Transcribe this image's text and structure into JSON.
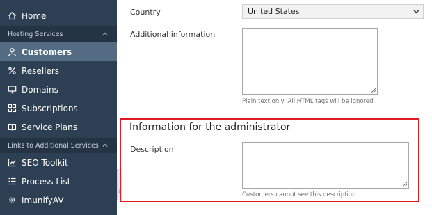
{
  "sidebar": {
    "home": "Home",
    "hosting_section": "Hosting Services",
    "items": [
      {
        "label": "Customers",
        "icon": "user-icon"
      },
      {
        "label": "Resellers",
        "icon": "percent-icon"
      },
      {
        "label": "Domains",
        "icon": "monitor-icon"
      },
      {
        "label": "Subscriptions",
        "icon": "grid-icon"
      },
      {
        "label": "Service Plans",
        "icon": "book-icon"
      }
    ],
    "links_section": "Links to Additional Services",
    "links": [
      {
        "label": "SEO Toolkit",
        "icon": "chart-icon"
      },
      {
        "label": "Process List",
        "icon": "list-icon"
      },
      {
        "label": "ImunifyAV",
        "icon": "gear-icon"
      }
    ],
    "active": "Customers",
    "colors": {
      "background": "#2d3f52",
      "active": "#536c84",
      "section": "#243445"
    }
  },
  "form": {
    "country_label": "Country",
    "country_value": "United States",
    "additional_label": "Additional information",
    "additional_value": "",
    "additional_hint": "Plain text only: All HTML tags will be ignored.",
    "admin_section_title": "Information for the administrator",
    "description_label": "Description",
    "description_value": "",
    "description_hint": "Customers cannot see this description."
  },
  "highlight_color": "#e21b23"
}
